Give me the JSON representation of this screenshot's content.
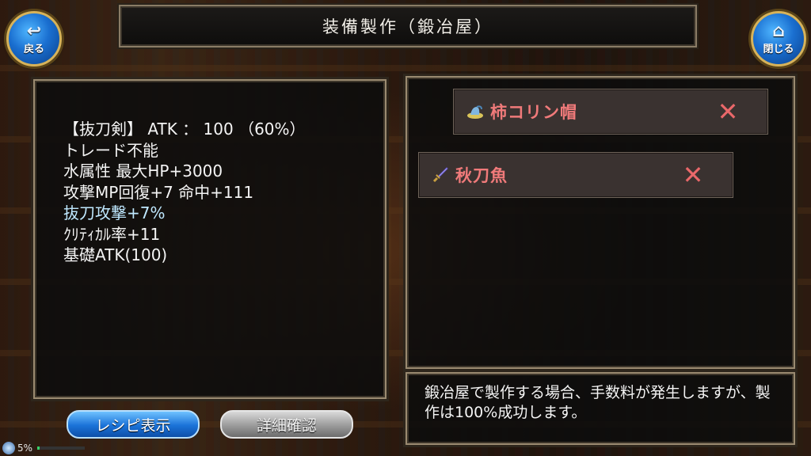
{
  "header": {
    "title": "装備製作（鍛冶屋）",
    "back_label": "戻る",
    "close_label": "閉じる",
    "back_icon": "return-arrow-icon",
    "close_icon": "home-icon"
  },
  "stats": [
    "【抜刀剣】 ATK ： 100 （60%）",
    "トレード不能",
    "水属性 最大HP+3000",
    "攻撃MP回復+7 命中+111",
    "抜刀攻撃+7%",
    "ｸﾘﾃｨｶﾙ率+11",
    "基礎ATK(100)"
  ],
  "materials": [
    {
      "name": "柿コリン帽",
      "icon": "hat-icon"
    },
    {
      "name": "秋刀魚",
      "icon": "sword-icon"
    }
  ],
  "message": "鍛冶屋で製作する場合、手数料が発生しますが、製作は100%成功します。",
  "buttons": {
    "recipe": "レシピ表示",
    "detail": "詳細確認"
  },
  "status": {
    "percent_label": "5%",
    "progress": 0.05
  },
  "colors": {
    "material_name": "#f07a7a",
    "highlight_stat": "#bfe8ff",
    "primary_button": "#1a72d8"
  }
}
